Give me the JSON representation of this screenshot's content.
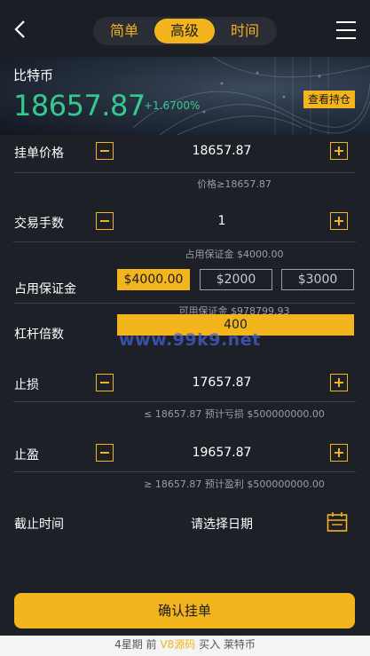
{
  "header": {
    "tabs": [
      "简单",
      "高级",
      "时间"
    ],
    "active_tab": "高级"
  },
  "banner": {
    "title": "比特币",
    "price": "18657.87",
    "change": "+1.6700%",
    "view_position": "查看持仓"
  },
  "limit_price": {
    "label": "挂单价格",
    "value": "18657.87",
    "hint": "价格≥18657.87"
  },
  "lots": {
    "label": "交易手数",
    "value": "1",
    "hint": "占用保证金 $4000.00"
  },
  "margin": {
    "label": "占用保证金",
    "options": [
      "$4000.00",
      "$2000",
      "$3000"
    ],
    "hint": "可用保证金 $978799.93"
  },
  "leverage": {
    "label": "杠杆倍数",
    "value": "400"
  },
  "stop_loss": {
    "label": "止损",
    "value": "17657.87",
    "hint": "≤ 18657.87 预计亏损 $500000000.00"
  },
  "take_profit": {
    "label": "止盈",
    "value": "19657.87",
    "hint": "≥ 18657.87 预计盈利 $500000000.00"
  },
  "expiry": {
    "label": "截止时间",
    "placeholder": "请选择日期"
  },
  "confirm_label": "确认挂单",
  "watermark": "www.99k9.net",
  "footer": {
    "part1": "4星期 前",
    "part2": "V8源码",
    "part3": "买入 莱特币"
  },
  "colors": {
    "accent": "#f2b51d",
    "up": "#36c98e",
    "background": "#1e2028"
  }
}
